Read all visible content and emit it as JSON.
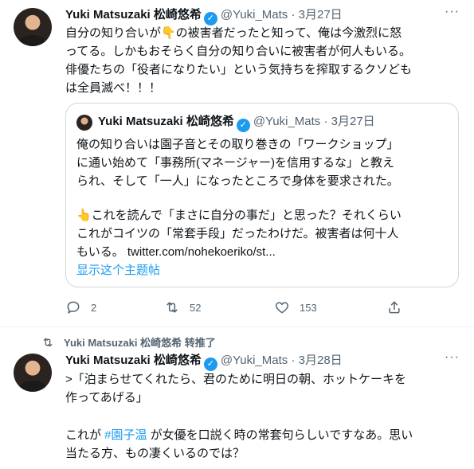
{
  "tweet1": {
    "name": "Yuki Matsuzaki 松崎悠希",
    "handle": "@Yuki_Mats",
    "dot": "·",
    "date": "3月27日",
    "more": "···",
    "lines": [
      "自分の知り合いが👇の被害者だったと知って、俺は今激烈に怒",
      "ってる。しかもおそらく自分の知り合いに被害者が何人もいる。",
      "俳優たちの「役者になりたい」という気持ちを搾取するクソども",
      "は全員滅べ！！！"
    ]
  },
  "quote": {
    "name": "Yuki Matsuzaki 松崎悠希",
    "handle": "@Yuki_Mats",
    "dot": "·",
    "date": "3月27日",
    "lines": [
      "俺の知り合いは園子音とその取り巻きの「ワークショップ」",
      "に通い始めて「事務所(マネージャー)を信用するな」と教え",
      "られ、そして「一人」になったところで身体を要求された。",
      "",
      "👆これを読んで「まさに自分の事だ」と思った？それくらい",
      "これがコイツの「常套手段」だったわけだ。被害者は何十人",
      "もいる。 twitter.com/nohekoeriko/st..."
    ],
    "show_thread": "显示这个主题帖"
  },
  "actions": {
    "reply": {
      "icon": "reply-icon",
      "count": "2"
    },
    "retweet": {
      "icon": "retweet-icon",
      "count": "52"
    },
    "like": {
      "icon": "heart-icon",
      "count": "153"
    },
    "share": {
      "icon": "share-icon"
    }
  },
  "retweet_banner": "Yuki Matsuzaki 松崎悠希 转推了",
  "tweet2": {
    "name": "Yuki Matsuzaki 松崎悠希",
    "handle": "@Yuki_Mats",
    "dot": "·",
    "date": "3月28日",
    "more": "···",
    "line1": ">「泊まらせてくれたら、君のために明日の朝、ホットケーキを",
    "line2": "作ってあげる」",
    "line3_pre": "これが ",
    "hashtag": "#園子温",
    "line3_post": " が女優を口説く時の常套句らしいですなあ。思い",
    "line4": "当たる方、もの凄くいるのでは？"
  },
  "colors": {
    "accent": "#1d9bf0",
    "muted": "#536471",
    "border": "#cfd9de"
  }
}
